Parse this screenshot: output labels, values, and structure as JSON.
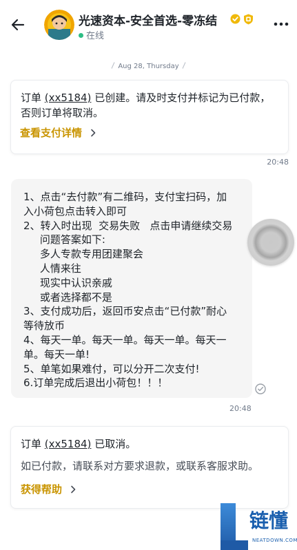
{
  "header": {
    "name": "光速资本-安全首选-零冻结",
    "status": "在线"
  },
  "date": "Aug 28, Thursday",
  "messages": {
    "order_created": {
      "prefix": "订单 ",
      "order_id": "(xx5184)",
      "suffix": " 已创建。请及时支付并标记为已付款，否则订单将取消。",
      "link": "查看支付详情",
      "time": "20:48"
    },
    "seller_note": {
      "text": "1、点击“去付款”有二维码，支付宝扫码，加\n入小荷包点击转入即可\n2、转入时出现  交易失败   点击申请继续交易\n     问题答案如下:\n     多人专款专用团建聚会\n     人情来往\n     现实中认识亲戚\n     或者选择都不是\n3、支付成功后，返回币安点击“已付款”耐心\n等待放币\n4、每天一单。每天一单。每天一单。每天一\n单。每天一单!\n5、单笔如果难付，可以分开二次支付!\n6.订单完成后退出小荷包！！！",
      "time": "20:48"
    },
    "order_cancelled": {
      "prefix": "订单 ",
      "order_id": "(xx5184)",
      "suffix": " 已取消。",
      "desc": "如已付款，请联系对方要求退款，或联系客服求助。",
      "link": "获得帮助"
    }
  },
  "watermark": {
    "text": "链懂",
    "sub": "NEATDOWN.COM"
  }
}
